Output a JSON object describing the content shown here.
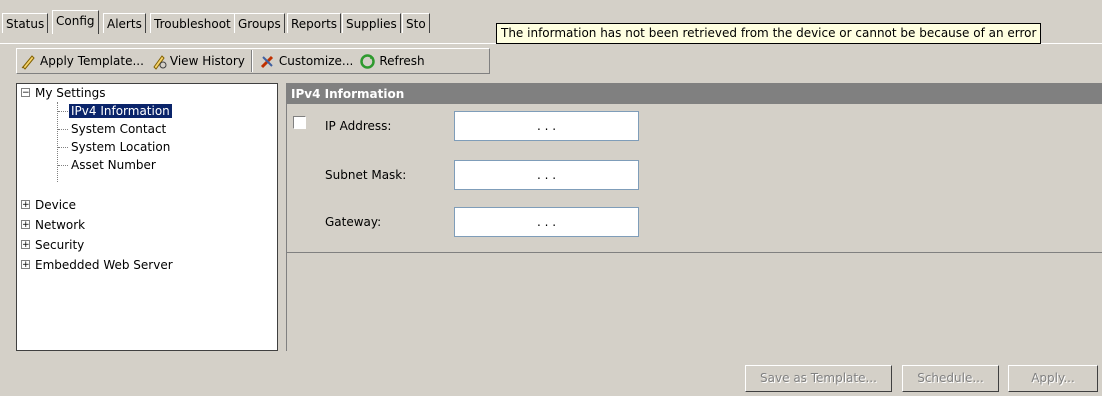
{
  "tabs": [
    "Status",
    "Config",
    "Alerts",
    "Troubleshoot",
    "Groups",
    "Reports",
    "Supplies",
    "Sto"
  ],
  "active_tab": "Config",
  "tooltip": "The information has not been retrieved from the device or cannot be because of an error",
  "toolbar": {
    "apply_template": "Apply Template...",
    "view_history": "View History",
    "customize": "Customize...",
    "refresh": "Refresh"
  },
  "tree": {
    "my_settings": "My Settings",
    "ipv4_information": "IPv4 Information",
    "system_contact": "System Contact",
    "system_location": "System Location",
    "asset_number": "Asset Number",
    "device": "Device",
    "network": "Network",
    "security": "Security",
    "embedded_web_server": "Embedded Web Server"
  },
  "panel": {
    "title": "IPv4 Information",
    "ip_address_label": "IP Address:",
    "subnet_mask_label": "Subnet Mask:",
    "gateway_label": "Gateway:",
    "ip_placeholder": ".   .   ."
  },
  "buttons": {
    "save_as_template": "Save as Template...",
    "schedule": "Schedule...",
    "apply": "Apply..."
  },
  "icons": [
    "apply-template-icon",
    "view-history-icon",
    "customize-icon",
    "refresh-icon"
  ]
}
